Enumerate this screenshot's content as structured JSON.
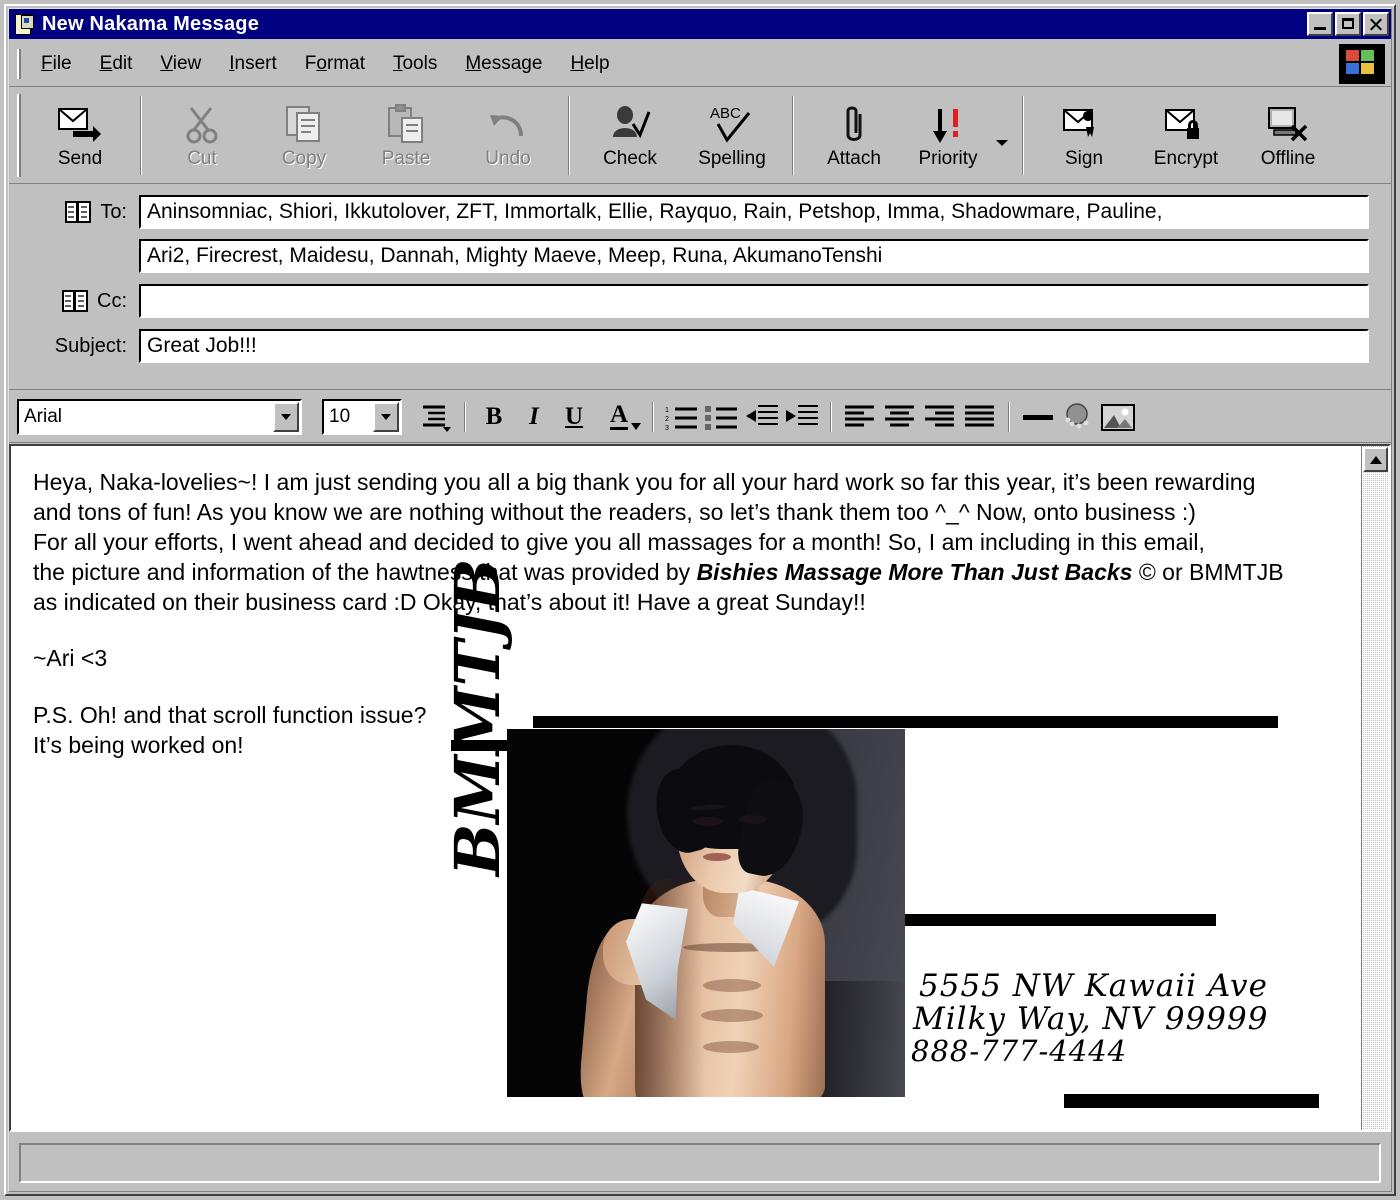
{
  "window": {
    "title": "New Nakama Message",
    "icon": "message-document-icon",
    "controls": {
      "minimize": "minimize-button",
      "maximize": "maximize-button",
      "close": "close-button"
    }
  },
  "menu": {
    "items": [
      {
        "label": "File",
        "accel": "F"
      },
      {
        "label": "Edit",
        "accel": "E"
      },
      {
        "label": "View",
        "accel": "V"
      },
      {
        "label": "Insert",
        "accel": "I"
      },
      {
        "label": "Format",
        "accel": "o"
      },
      {
        "label": "Tools",
        "accel": "T"
      },
      {
        "label": "Message",
        "accel": "M"
      },
      {
        "label": "Help",
        "accel": "H"
      }
    ]
  },
  "toolbar": {
    "buttons": [
      {
        "label": "Send",
        "icon": "send-envelope-icon",
        "enabled": true
      },
      {
        "label": "Cut",
        "icon": "scissors-icon",
        "enabled": false
      },
      {
        "label": "Copy",
        "icon": "copy-pages-icon",
        "enabled": false
      },
      {
        "label": "Paste",
        "icon": "clipboard-paste-icon",
        "enabled": false
      },
      {
        "label": "Undo",
        "icon": "undo-arrow-icon",
        "enabled": false
      },
      {
        "label": "Check",
        "icon": "check-names-icon",
        "enabled": true
      },
      {
        "label": "Spelling",
        "icon": "abc-spellcheck-icon",
        "enabled": true
      },
      {
        "label": "Attach",
        "icon": "paperclip-icon",
        "enabled": true
      },
      {
        "label": "Priority",
        "icon": "priority-arrow-icon",
        "enabled": true
      },
      {
        "label": "Sign",
        "icon": "sign-envelope-icon",
        "enabled": true
      },
      {
        "label": "Encrypt",
        "icon": "encrypt-envelope-icon",
        "enabled": true
      },
      {
        "label": "Offline",
        "icon": "offline-monitor-icon",
        "enabled": true
      }
    ]
  },
  "headers": {
    "to_label": "To:",
    "cc_label": "Cc:",
    "subject_label": "Subject:",
    "to_line1": "Aninsomniac, Shiori, Ikkutolover, ZFT, Immortalk, Ellie, Rayquo, Rain, Petshop, Imma, Shadowmare, Pauline,",
    "to_line2": "Ari2, Firecrest, Maidesu, Dannah, Mighty Maeve, Meep, Runa, AkumanoTenshi",
    "cc_value": "",
    "subject_value": "Great Job!!!"
  },
  "format_toolbar": {
    "font_name": "Arial",
    "font_size": "10",
    "buttons": [
      {
        "name": "paragraph-style-icon",
        "glyph": "≡"
      },
      {
        "name": "bold-icon",
        "glyph": "B"
      },
      {
        "name": "italic-icon",
        "glyph": "I"
      },
      {
        "name": "underline-icon",
        "glyph": "U"
      },
      {
        "name": "font-color-icon",
        "glyph": "A"
      },
      {
        "name": "numbered-list-icon",
        "glyph": "≡"
      },
      {
        "name": "bulleted-list-icon",
        "glyph": "≡"
      },
      {
        "name": "decrease-indent-icon",
        "glyph": "←"
      },
      {
        "name": "increase-indent-icon",
        "glyph": "→"
      },
      {
        "name": "align-left-icon",
        "glyph": "≡"
      },
      {
        "name": "align-center-icon",
        "glyph": "≡"
      },
      {
        "name": "align-right-icon",
        "glyph": "≡"
      },
      {
        "name": "justify-icon",
        "glyph": "≡"
      },
      {
        "name": "horizontal-line-icon",
        "glyph": "—"
      },
      {
        "name": "insert-link-icon",
        "glyph": "⚭"
      },
      {
        "name": "insert-picture-icon",
        "glyph": "⛰"
      }
    ]
  },
  "message_body": {
    "line1": "Heya, Naka-lovelies~! I am just sending you all a big thank you for all your hard work so far this year, it’s been rewarding",
    "line2": "and tons of fun! As you know we are nothing without the readers, so let’s thank them too ^_^ Now, onto business :)",
    "line3": "For all your efforts, I went ahead and decided to give you all massages for a month! So, I am including in this email,",
    "line4_pre": "the picture and information of the hawtness that was provided by ",
    "line4_company": "Bishies Massage More Than Just Backs",
    "line4_post": " © or BMMTJB",
    "line5": "as indicated on their business card :D Okay, that’s about it! Have a great Sunday!!",
    "signature": "~Ari <3",
    "ps_line1": "P.S. Oh! and that scroll function issue?",
    "ps_line2": "It’s being worked on!"
  },
  "business_card": {
    "logo": "BMMTJB",
    "vertical_logo": "BMMTJB",
    "address_line1": "5555 NW Kawaii Ave",
    "address_line2": "Milky Way, NV 99999",
    "phone": "888-777-4444",
    "photo_alt": "shirtless-man-illustration"
  },
  "status_bar": {
    "text": ""
  },
  "colors": {
    "titlebar": "#000080",
    "chrome": "#c0c0c0",
    "body_background": "#ffffff",
    "text": "#000000",
    "disabled_text": "#808080"
  }
}
